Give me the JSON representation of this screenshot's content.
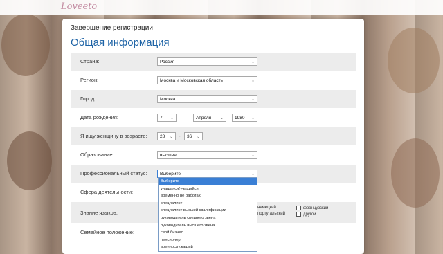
{
  "app": {
    "logo": "Loveeto"
  },
  "page": {
    "step_title": "Завершение регистрации",
    "heading": "Общая информация"
  },
  "form": {
    "country": {
      "label": "Страна:",
      "value": "Россия"
    },
    "region": {
      "label": "Регион:",
      "value": "Москва и Московская область"
    },
    "city": {
      "label": "Город:",
      "value": "Москва"
    },
    "birth": {
      "label": "Дата рождения:",
      "day": "7",
      "month": "Апреля",
      "year": "1980"
    },
    "seeking": {
      "label": "Я ищу женщину в возрасте:",
      "from": "28",
      "dash": "-",
      "to": "36"
    },
    "education": {
      "label": "Образование:",
      "value": "высшее"
    },
    "profession": {
      "label": "Профессиональный статус:",
      "value": "Выберите",
      "options": [
        "Выберите",
        "учащаяся(учащийся",
        "временно не работаю",
        "специалист",
        "специалист высшей квалификации",
        "руководитель среднего звена",
        "руководитель высшего звена",
        "свой бизнес",
        "пенсионер",
        "военнослужащий"
      ]
    },
    "activity": {
      "label": "Сфера деятельности:"
    },
    "languages": {
      "label": "Знание языков:",
      "items": [
        "немецкий",
        "французский",
        "португальский",
        "другой"
      ]
    },
    "marital": {
      "label": "Семейное положение:"
    }
  },
  "colors": {
    "heading": "#1d63a6",
    "selected_option": "#3a7fd5"
  }
}
